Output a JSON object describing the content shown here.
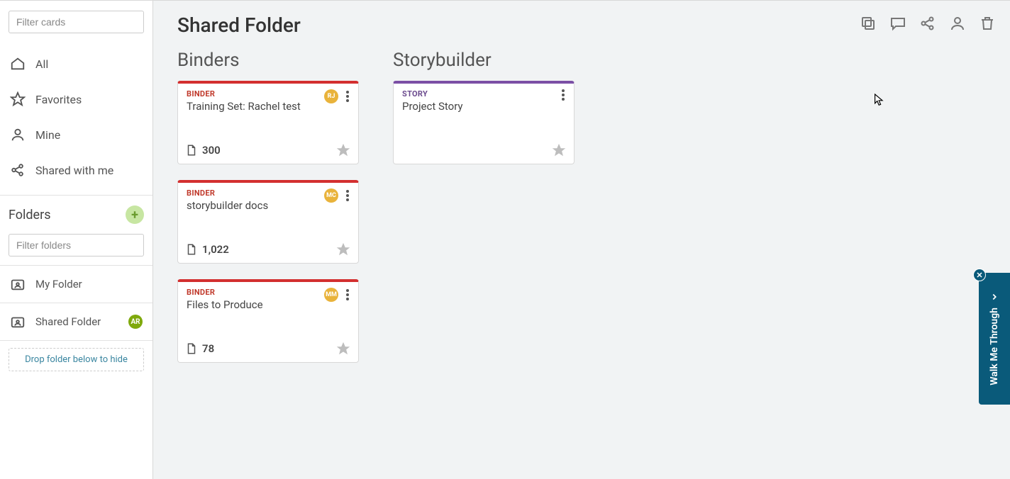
{
  "sidebar": {
    "filter_cards_placeholder": "Filter cards",
    "nav": {
      "all": "All",
      "favorites": "Favorites",
      "mine": "Mine",
      "shared": "Shared with me"
    },
    "folders_header": "Folders",
    "filter_folders_placeholder": "Filter folders",
    "folders": [
      {
        "label": "My Folder"
      },
      {
        "label": "Shared Folder",
        "avatar": "AR"
      }
    ],
    "drop_hint": "Drop folder below to hide"
  },
  "main": {
    "title": "Shared Folder",
    "columns": {
      "binders_header": "Binders",
      "storybuilder_header": "Storybuilder"
    },
    "binders": [
      {
        "type_label": "BINDER",
        "title": "Training Set: Rachel test",
        "count": "300",
        "avatar": "RJ",
        "avatar_color": "#e9b33b"
      },
      {
        "type_label": "BINDER",
        "title": "storybuilder docs",
        "count": "1,022",
        "avatar": "MC",
        "avatar_color": "#e9b33b"
      },
      {
        "type_label": "BINDER",
        "title": "Files to Produce",
        "count": "78",
        "avatar": "MM",
        "avatar_color": "#e9b33b"
      }
    ],
    "stories": [
      {
        "type_label": "STORY",
        "title": "Project Story"
      }
    ]
  },
  "walkme": {
    "label": "Walk Me Through"
  }
}
